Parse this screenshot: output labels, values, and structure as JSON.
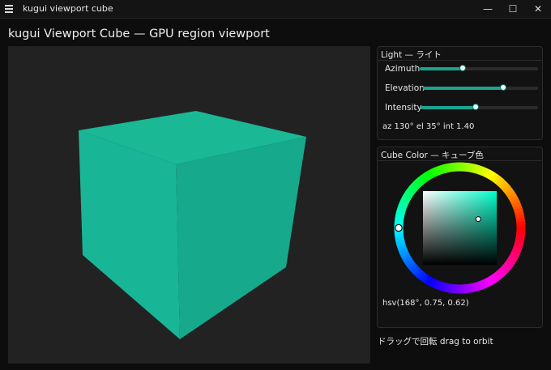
{
  "window": {
    "title": "kugui viewport cube",
    "buttons": {
      "minimize": "—",
      "maximize": "☐",
      "close": "✕"
    }
  },
  "page": {
    "title": "kugui Viewport Cube — GPU region viewport"
  },
  "colors": {
    "accent": "#1aa590",
    "cube_front": "#19b597",
    "cube_top": "#1ab895",
    "cube_side": "#16a98b",
    "viewport_bg": "#222222"
  },
  "light": {
    "title": "Light — ライト",
    "azimuth": {
      "label": "Azimuth",
      "value": 130,
      "min": 0,
      "max": 360
    },
    "elevation": {
      "label": "Elevation",
      "value": 35,
      "min": -90,
      "max": 90
    },
    "intensity": {
      "label": "Intensity",
      "value": 1.4,
      "min": 0,
      "max": 3
    },
    "readout": "az 130°  el 35°  int 1.40"
  },
  "cube_color": {
    "title": "Cube Color — キューブ色",
    "hsv": {
      "h": 168,
      "s": 0.75,
      "v": 0.62
    },
    "readout": "hsv(168°, 0.75, 0.62)"
  },
  "hint": "ドラッグで回転 drag to orbit"
}
